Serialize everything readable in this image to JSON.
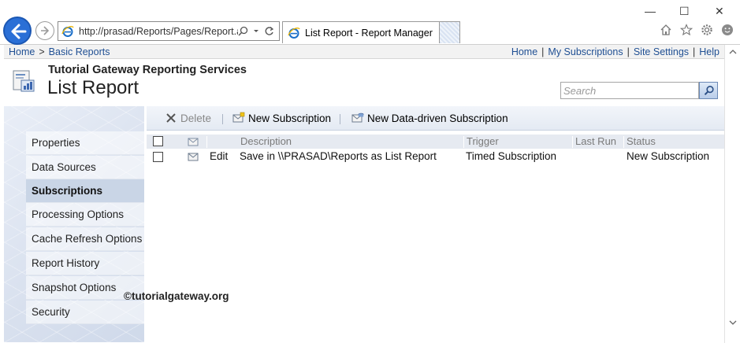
{
  "browser": {
    "address_url": "http://prasad/Reports/Pages/Report.a",
    "tab_title": "List Report - Report Manager",
    "tab_close_glyph": "✕",
    "window_controls": [
      "—",
      "☐",
      "✕"
    ]
  },
  "topbar": {
    "breadcrumb": [
      "Home",
      "Basic Reports"
    ],
    "breadcrumb_sep": ">",
    "links": [
      "Home",
      "My Subscriptions",
      "Site Settings",
      "Help"
    ],
    "link_sep": "|"
  },
  "header": {
    "site_name": "Tutorial Gateway Reporting Services",
    "page_title": "List Report",
    "search_placeholder": "Search"
  },
  "leftnav": {
    "items": [
      {
        "label": "Properties",
        "active": false
      },
      {
        "label": "Data Sources",
        "active": false
      },
      {
        "label": "Subscriptions",
        "active": true
      },
      {
        "label": "Processing Options",
        "active": false
      },
      {
        "label": "Cache Refresh Options",
        "active": false
      },
      {
        "label": "Report History",
        "active": false
      },
      {
        "label": "Snapshot Options",
        "active": false
      },
      {
        "label": "Security",
        "active": false
      }
    ]
  },
  "toolbar": {
    "delete_label": "Delete",
    "new_subscription_label": "New Subscription",
    "new_data_driven_label": "New Data-driven Subscription"
  },
  "grid": {
    "columns": [
      "Description",
      "Trigger",
      "Last Run",
      "Status"
    ],
    "rows": [
      {
        "edit_label": "Edit",
        "description": "Save in \\\\PRASAD\\Reports as List Report",
        "trigger": "Timed Subscription",
        "last_run": "",
        "status": "New Subscription"
      }
    ]
  },
  "watermark": "©tutorialgateway.org",
  "colors": {
    "link": "#1f4f93",
    "active_nav": "#c9d5e6",
    "browser_back": "#2a6fd6"
  }
}
